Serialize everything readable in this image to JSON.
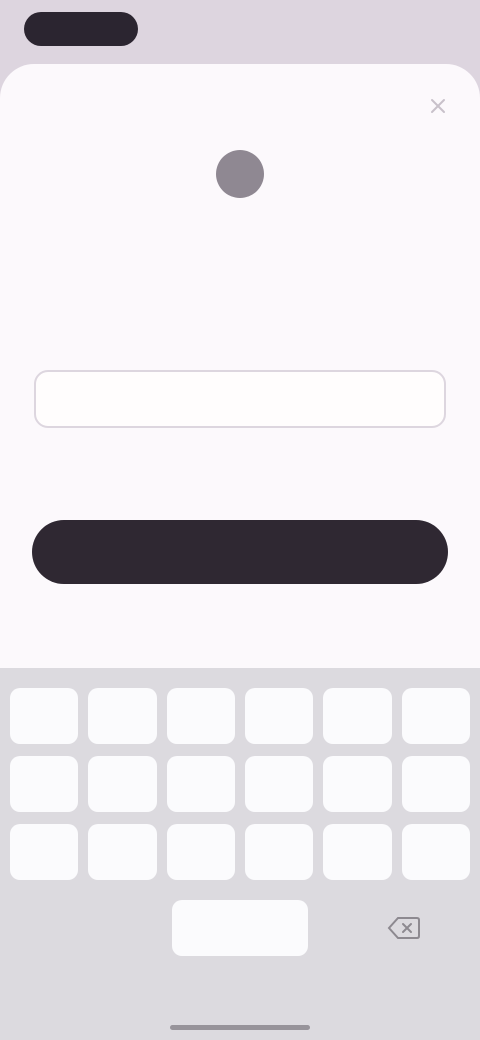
{
  "sheet": {
    "close_icon": "close-icon",
    "brand_icon": "circle-logo-icon"
  },
  "form": {
    "label": "",
    "input_value": "",
    "input_placeholder": "",
    "helper": "",
    "button_label": ""
  },
  "keyboard": {
    "rows": [
      [
        "",
        "",
        "",
        "",
        "",
        ""
      ],
      [
        "",
        "",
        "",
        "",
        "",
        ""
      ],
      [
        "",
        "",
        "",
        "",
        "",
        ""
      ]
    ],
    "space_label": "",
    "backspace_icon": "backspace-icon"
  },
  "colors": {
    "background": "#ddd5df",
    "sheet": "#fcf9fc",
    "button": "#2f2832",
    "keyboard": "#dcdadf"
  }
}
